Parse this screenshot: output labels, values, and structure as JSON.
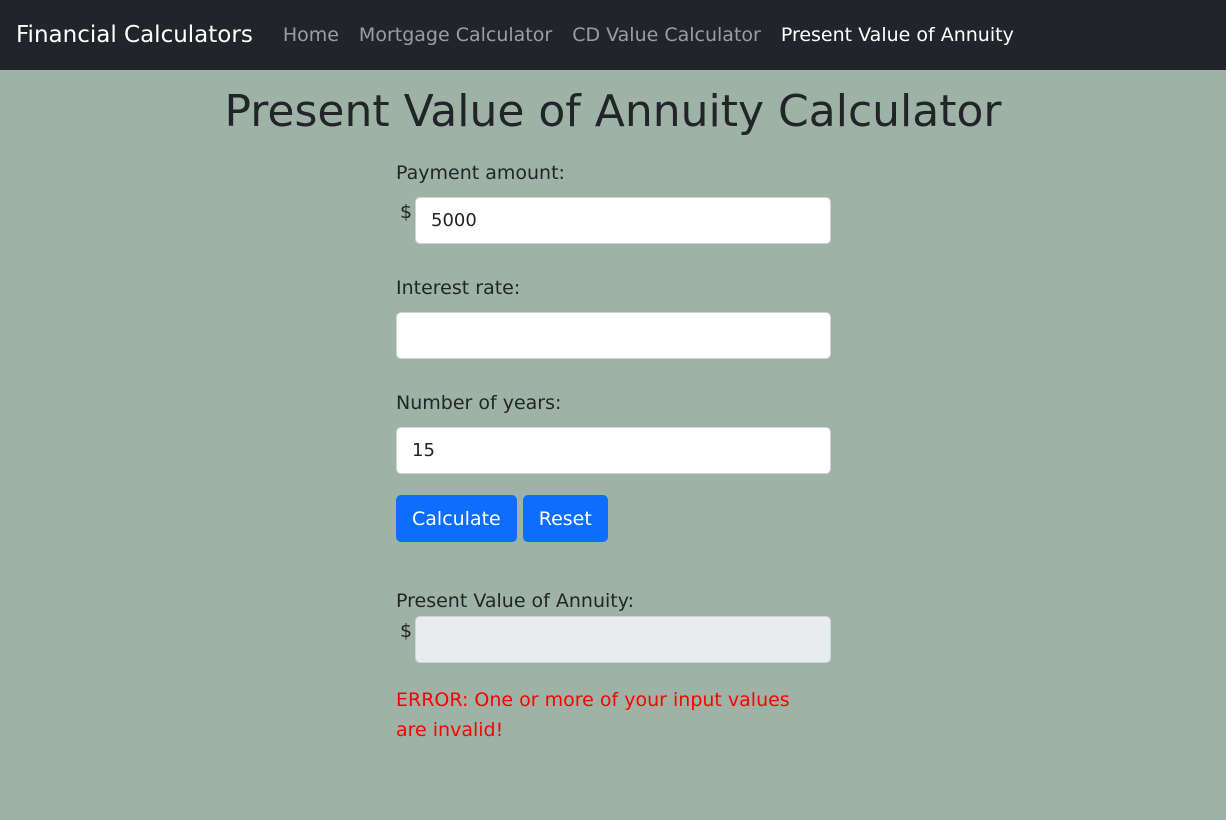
{
  "navbar": {
    "brand": "Financial Calculators",
    "links": [
      {
        "label": "Home"
      },
      {
        "label": "Mortgage Calculator"
      },
      {
        "label": "CD Value Calculator"
      },
      {
        "label": "Present Value of Annuity"
      }
    ],
    "active_index": 3
  },
  "page": {
    "title": "Present Value of Annuity Calculator"
  },
  "form": {
    "payment": {
      "label": "Payment amount:",
      "prefix": "$",
      "value": "5000"
    },
    "interest": {
      "label": "Interest rate:",
      "value": ""
    },
    "years": {
      "label": "Number of years:",
      "value": "15"
    },
    "calculate_label": "Calculate",
    "reset_label": "Reset",
    "result": {
      "label": "Present Value of Annuity:",
      "prefix": "$",
      "value": ""
    },
    "error": "ERROR: One or more of your input values are invalid!"
  },
  "colors": {
    "background": "#9fb2a6",
    "navbar": "#212529",
    "primary": "#0d6efd",
    "error": "#ff0000"
  }
}
